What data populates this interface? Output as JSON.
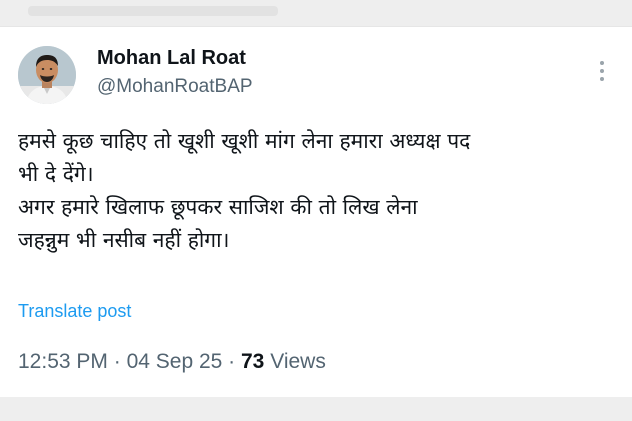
{
  "post": {
    "author": {
      "name": "Mohan Lal Roat",
      "handle": "@MohanRoatBAP",
      "avatar_icon": "profile-photo"
    },
    "more_icon": "more-vertical-icon",
    "text_lines": [
      "हमसे कूछ चाहिए तो खूशी खूशी मांग लेना हमारा अध्यक्ष पद",
      "भी दे देंगे।",
      "अगर हमारे खिलाफ छूपकर साजिश की तो लिख लेना",
      "जहन्नुम भी नसीब नहीं होगा।"
    ],
    "translate_label": "Translate post",
    "time": "12:53 PM",
    "separator": " · ",
    "date": "04 Sep 25",
    "views_count": "73",
    "views_label": "Views",
    "colors": {
      "link": "#1d9bf0",
      "text": "#0f1419",
      "secondary": "#536471"
    }
  }
}
